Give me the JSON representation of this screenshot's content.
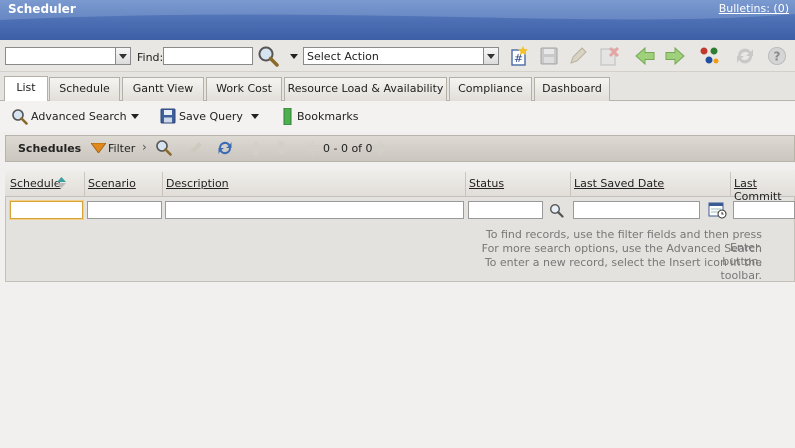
{
  "app": {
    "title": "Scheduler",
    "bulletins_label": "Bulletins: (0)"
  },
  "toolbar": {
    "find_label": "Find:",
    "find_value": "",
    "query_value": "",
    "action_select": "Select Action"
  },
  "tabs": [
    {
      "label": "List",
      "active": true
    },
    {
      "label": "Schedule"
    },
    {
      "label": "Gantt View"
    },
    {
      "label": "Work Cost"
    },
    {
      "label": "Resource Load & Availability"
    },
    {
      "label": "Compliance"
    },
    {
      "label": "Dashboard"
    }
  ],
  "actions": {
    "advanced_search": "Advanced Search",
    "save_query": "Save Query",
    "bookmarks": "Bookmarks"
  },
  "results": {
    "title": "Schedules",
    "filter_label": "Filter",
    "pager_text": "0 - 0 of 0"
  },
  "columns": [
    "Schedule",
    "Scenario",
    "Description",
    "Status",
    "Last Saved Date",
    "Last Committ"
  ],
  "messages": [
    "To find records, use the filter fields and then press Enter.",
    "For more search options, use the Advanced Search button.",
    "To enter a new record, select the Insert icon in the toolbar."
  ],
  "colors": {
    "title_bar": "#4f71b6",
    "focus_border": "#d8a23a"
  }
}
